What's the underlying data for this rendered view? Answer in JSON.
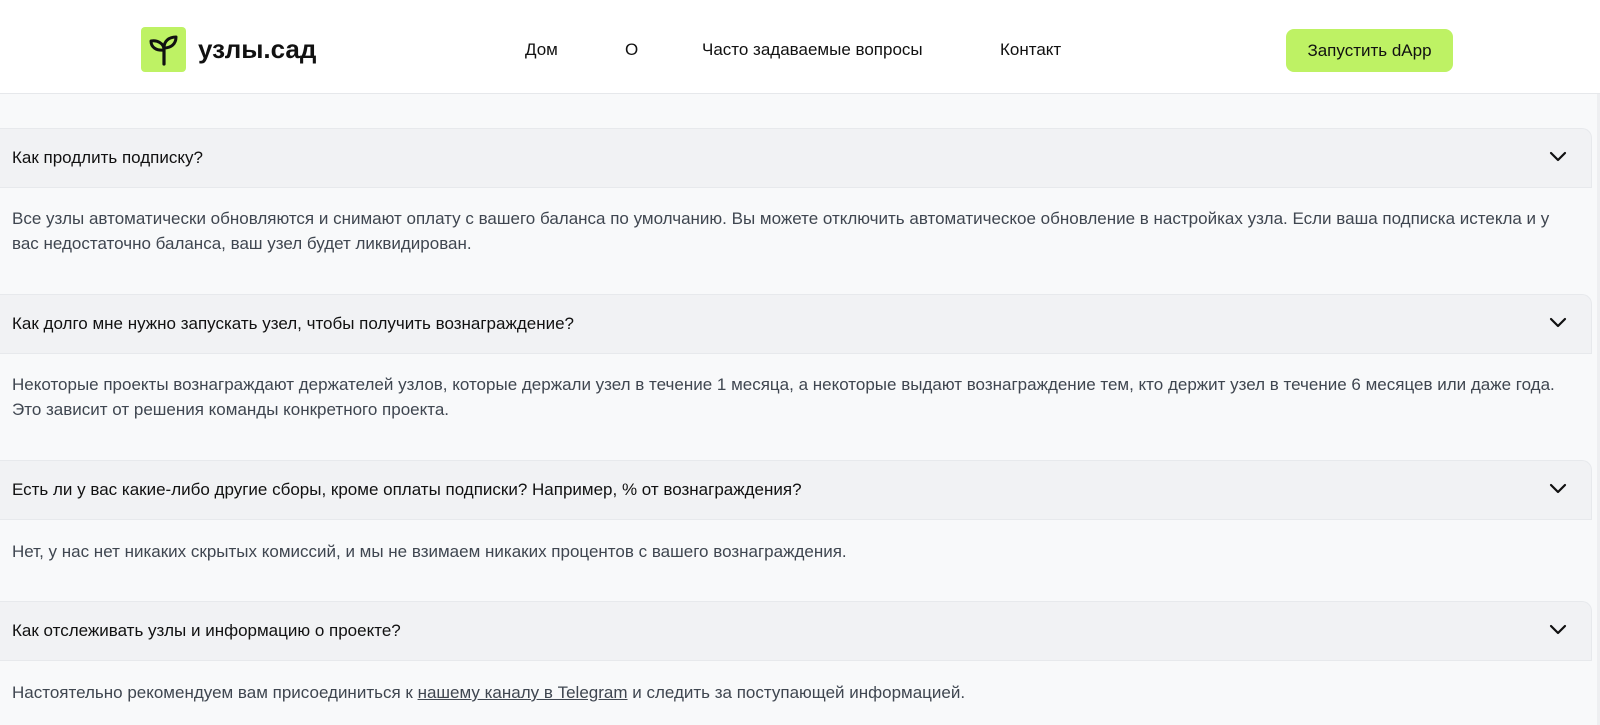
{
  "brand": {
    "name": "узлы.сад",
    "logo_icon": "sprout-icon",
    "accent_color": "#bef264"
  },
  "nav": {
    "items": [
      {
        "label": "Дом"
      },
      {
        "label": "О"
      },
      {
        "label": "Часто задаваемые вопросы"
      },
      {
        "label": "Контакт"
      }
    ],
    "cta_label": "Запустить dApp"
  },
  "faq": [
    {
      "question": "Как продлить подписку?",
      "answer": "Все узлы автоматически обновляются и снимают оплату с вашего баланса по умолчанию. Вы можете отключить автоматическое обновление в настройках узла. Если ваша подписка истекла и у вас недостаточно баланса, ваш узел будет ликвидирован."
    },
    {
      "question": "Как долго мне нужно запускать узел, чтобы получить вознаграждение?",
      "answer": "Некоторые проекты вознаграждают держателей узлов, которые держали узел в течение 1 месяца, а некоторые выдают вознаграждение тем, кто держит узел в течение 6 месяцев или даже года. Это зависит от решения команды конкретного проекта."
    },
    {
      "question": "Есть ли у вас какие-либо другие сборы, кроме оплаты подписки? Например, % от вознаграждения?",
      "answer": "Нет, у нас нет никаких скрытых комиссий, и мы не взимаем никаких процентов с вашего вознаграждения."
    },
    {
      "question": "Как отслеживать узлы и информацию о проекте?",
      "answer_before": "Настоятельно рекомендуем вам присоединиться к ",
      "answer_link": "нашему каналу в Telegram",
      "answer_after": " и следить за поступающей информацией."
    }
  ]
}
